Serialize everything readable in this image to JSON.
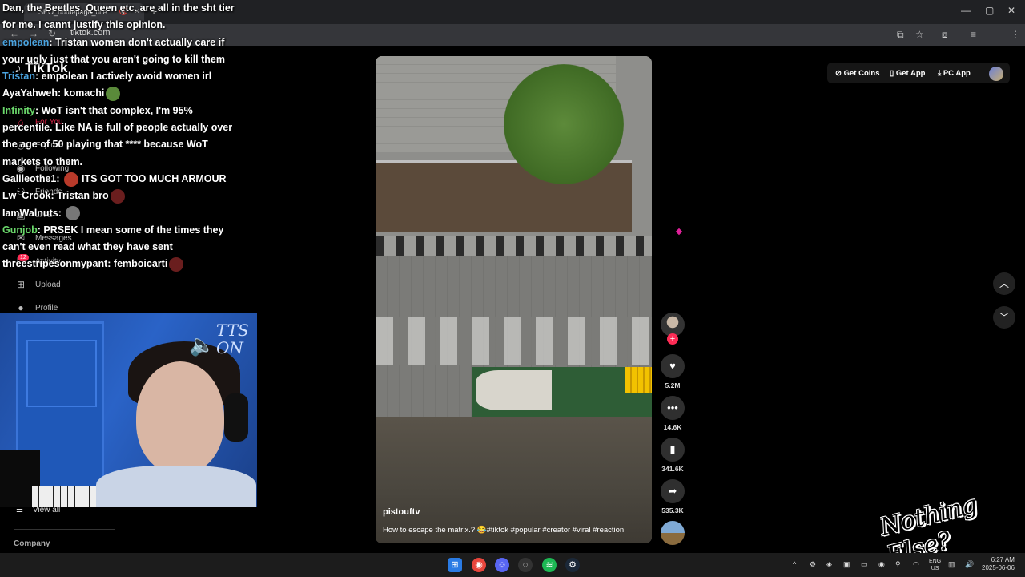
{
  "browser": {
    "tab_title": "SEO_homepage_title",
    "url": "tiktok.com",
    "tab_close": "×",
    "new_tab": "+",
    "back": "←",
    "forward": "→",
    "reload": "↻",
    "minimize": "—",
    "maximize": "▢",
    "close": "✕"
  },
  "tiktok": {
    "logo": "TikTok",
    "nav": [
      {
        "label": "For You",
        "icon": "home-icon"
      },
      {
        "label": "Explore",
        "icon": "compass-icon"
      },
      {
        "label": "Following",
        "icon": "following-icon"
      },
      {
        "label": "Friends",
        "icon": "friends-icon"
      },
      {
        "label": "LIVE",
        "icon": "live-icon"
      },
      {
        "label": "Messages",
        "icon": "messages-icon"
      },
      {
        "label": "Activity",
        "icon": "activity-icon"
      },
      {
        "label": "Upload",
        "icon": "upload-icon"
      },
      {
        "label": "Profile",
        "icon": "profile-icon"
      }
    ],
    "activity_badge": "12",
    "view_all": "View all",
    "company": "Company",
    "header": {
      "get_coins": "Get Coins",
      "get_app": "Get App",
      "pc_app": "PC App"
    },
    "video": {
      "username": "pistouftv",
      "caption": "How to escape the matrix.? 😂#tiktok #popular #creator #viral #reaction",
      "likes": "5.2M",
      "comments": "14.6K",
      "saves": "341.6K",
      "shares": "535.3K"
    }
  },
  "chat": [
    {
      "user": "",
      "color": "#ffffff",
      "text": "Dan, the Beetles, Queen etc. are all in the sht tier for me. I cannt justify this opinion."
    },
    {
      "user": "empolean",
      "color": "#4aa3df",
      "text": ": Tristan women don't actually care if your ugly just that you aren't going to kill them"
    },
    {
      "user": "Tristan",
      "color": "#4aa3df",
      "text": ": empolean I actively avoid women irl"
    },
    {
      "user": "AyaYahweh",
      "color": "#ffffff",
      "text": ": komachi",
      "emote": "#5a8a3a"
    },
    {
      "user": "Infinity",
      "color": "#6bd86b",
      "text": ": WoT isn't that complex, I'm 95% percentile. Like NA is full of people actually over the age of 50 playing that **** because WoT markets to them."
    },
    {
      "user": "Galileothe1",
      "color": "#ffffff",
      "text": ": ",
      "emote": "#b83a2a",
      "after": "ITS GOT TOO MUCH ARMOUR"
    },
    {
      "user": "Lw_Crook",
      "color": "#ffffff",
      "text": ": Tristan bro",
      "emote": "#6a1e1e"
    },
    {
      "user": "IamWalnuts",
      "color": "#ffffff",
      "text": ": ",
      "emote": "#777777"
    },
    {
      "user": "Gunjob",
      "color": "#6bd86b",
      "text": ": PRSEK I mean some of the times they can't even read what they have sent"
    },
    {
      "user": "threestripesonmypant",
      "color": "#ffffff",
      "text": ": femboicarti",
      "emote": "#6a1e1e"
    }
  ],
  "overlay": {
    "tts_label": "TTS ON",
    "logo_text": "Nothing Else?"
  },
  "taskbar": {
    "lang_top": "ENG",
    "lang_bottom": "US",
    "time": "6:27 AM",
    "date": "2025-06-06"
  }
}
